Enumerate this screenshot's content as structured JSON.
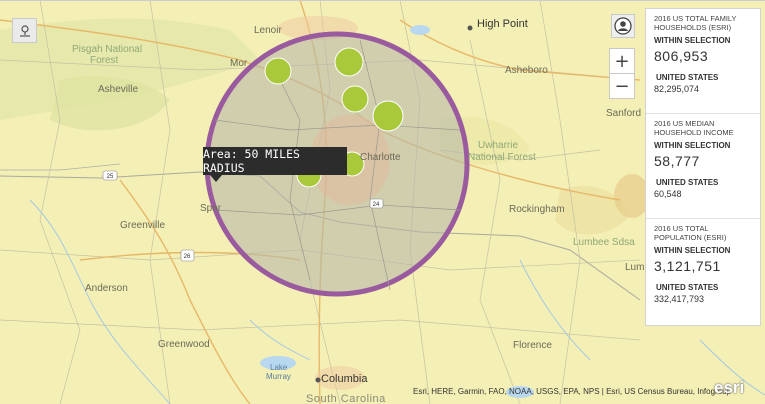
{
  "map": {
    "labels": {
      "high_point": "High Point",
      "pisgah": "Pisgah National",
      "forest": "Forest",
      "lenoir": "Lenoir",
      "asheboro": "Asheboro",
      "asheville": "Asheville",
      "mor": "Mor",
      "uwharrie_1": "Uwharrie",
      "uwharrie_2": "National Forest",
      "sanford": "Sanford",
      "rockingham": "Rockingham",
      "spartanburg": "Spar",
      "greenville": "Greenville",
      "anderson": "Anderson",
      "greenwood": "Greenwood",
      "lumbee": "Lumbee Sdsa",
      "lum": "Lum",
      "florence": "Florence",
      "columbia": "Columbia",
      "south_carolina": "South Carolina",
      "lake_murray_1": "Lake",
      "lake_murray_2": "Murray",
      "charlotte": "Charlotte",
      "route_25": "25",
      "route_26": "26",
      "route_24": "24"
    },
    "selection_colors": {
      "ring": "#9a5a9e",
      "fill": "#b8b8a8",
      "cluster": "#a9c83a"
    }
  },
  "tooltip": {
    "text": "Area: 50 MILES RADIUS"
  },
  "controls": {
    "sketch_tool_icon": "map-pin-draw-icon",
    "user_icon": "user-icon",
    "zoom_in": "+",
    "zoom_out": "−"
  },
  "infopanel": {
    "cards": [
      {
        "title": "2016 US TOTAL FAMILY HOUSEHOLDS (ESRI)",
        "within_label": "WITHIN SELECTION",
        "within_value": "806,953",
        "us_label": "UNITED STATES",
        "us_value": "82,295,074"
      },
      {
        "title": "2016 US MEDIAN HOUSEHOLD INCOME",
        "within_label": "WITHIN SELECTION",
        "within_value": "58,777",
        "us_label": "UNITED STATES",
        "us_value": "60,548"
      },
      {
        "title": "2016 US TOTAL POPULATION (ESRI)",
        "within_label": "WITHIN SELECTION",
        "within_value": "3,121,751",
        "us_label": "UNITED STATES",
        "us_value": "332,417,793"
      }
    ]
  },
  "attribution": "Esri, HERE, Garmin, FAO, NOAA, USGS, EPA, NPS | Esri, US Census Bureau, Infogroup",
  "logo": "esri"
}
